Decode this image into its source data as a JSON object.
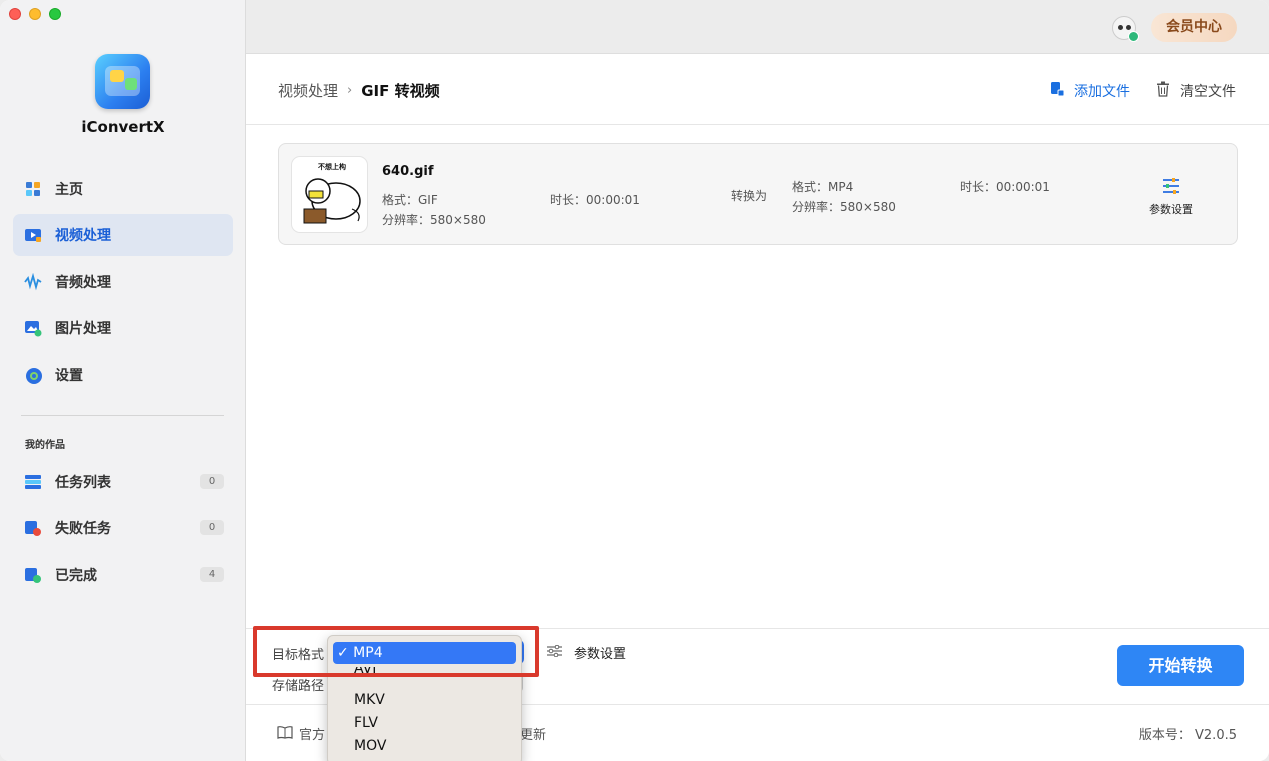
{
  "app": {
    "name": "iConvertX"
  },
  "sidebar": {
    "items": [
      {
        "label": "主页",
        "icon": "home-icon"
      },
      {
        "label": "视频处理",
        "icon": "video-icon",
        "active": true
      },
      {
        "label": "音频处理",
        "icon": "audio-wave-icon"
      },
      {
        "label": "图片处理",
        "icon": "image-icon"
      },
      {
        "label": "设置",
        "icon": "gear-icon"
      }
    ],
    "section_label": "我的作品",
    "works": [
      {
        "label": "任务列表",
        "count": "0",
        "icon": "task-list-icon"
      },
      {
        "label": "失败任务",
        "count": "0",
        "icon": "failed-task-icon"
      },
      {
        "label": "已完成",
        "count": "4",
        "icon": "completed-icon"
      }
    ]
  },
  "topbar": {
    "vip_label": "会员中心"
  },
  "header": {
    "breadcrumb_parent": "视频处理",
    "breadcrumb_separator": "›",
    "breadcrumb_current": "GIF 转视频",
    "add_file": "添加文件",
    "clear_files": "清空文件"
  },
  "file": {
    "thumbnail_text": "不想上构",
    "name": "640.gif",
    "source_format": "格式：GIF",
    "source_resolution": "分辨率：580×580",
    "source_duration": "时长：00:00:01",
    "convert_to": "转换为",
    "target_format": "格式：MP4",
    "target_resolution": "分辨率：580×580",
    "target_duration": "时长：00:00:01",
    "param_settings": "参数设置"
  },
  "bottom": {
    "target_format_label": "目标格式",
    "save_path_label": "存储路径",
    "param_settings": "参数设置",
    "start_button": "开始转换",
    "footer_official": "官方",
    "footer_update": "更新",
    "version": "版本号： V2.0.5"
  },
  "format_dropdown": {
    "selected": "✓ MP4",
    "options": [
      "AVI",
      "MKV",
      "FLV",
      "MOV"
    ]
  },
  "colors": {
    "accent": "#2e86f5",
    "highlight_box": "#d9392c",
    "vip_text": "#8a4a1c"
  }
}
